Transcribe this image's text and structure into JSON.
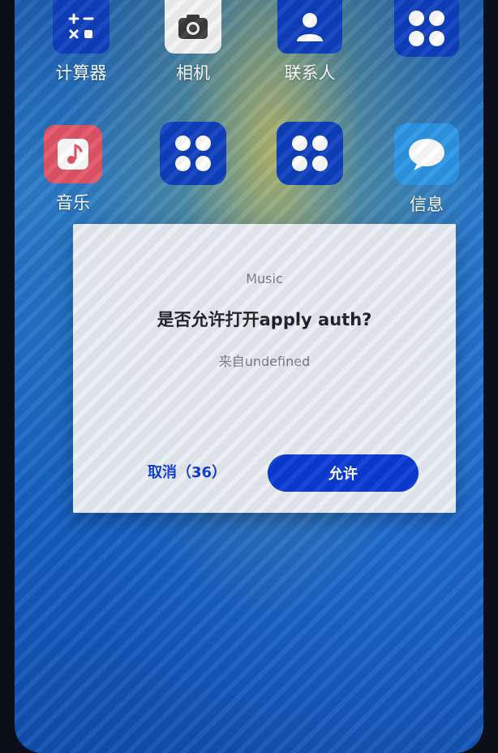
{
  "home": {
    "apps_row1": [
      {
        "label": "计算器",
        "icon": "calculator-icon"
      },
      {
        "label": "相机",
        "icon": "camera-icon"
      },
      {
        "label": "联系人",
        "icon": "contacts-icon"
      },
      {
        "label": "",
        "icon": "app-grid-icon"
      }
    ],
    "apps_row2": [
      {
        "label": "音乐",
        "icon": "music-icon"
      },
      {
        "label": "",
        "icon": "app-grid-icon"
      },
      {
        "label": "",
        "icon": "app-grid-icon"
      },
      {
        "label": "信息",
        "icon": "messages-icon"
      }
    ]
  },
  "dialog": {
    "app_name": "Music",
    "title": "是否允许打开apply auth?",
    "subtitle": "来自undefined",
    "cancel_label": "取消（36）",
    "allow_label": "允许"
  },
  "colors": {
    "accent": "#0b3bd6",
    "dialog_bg": "#eef0f5"
  }
}
